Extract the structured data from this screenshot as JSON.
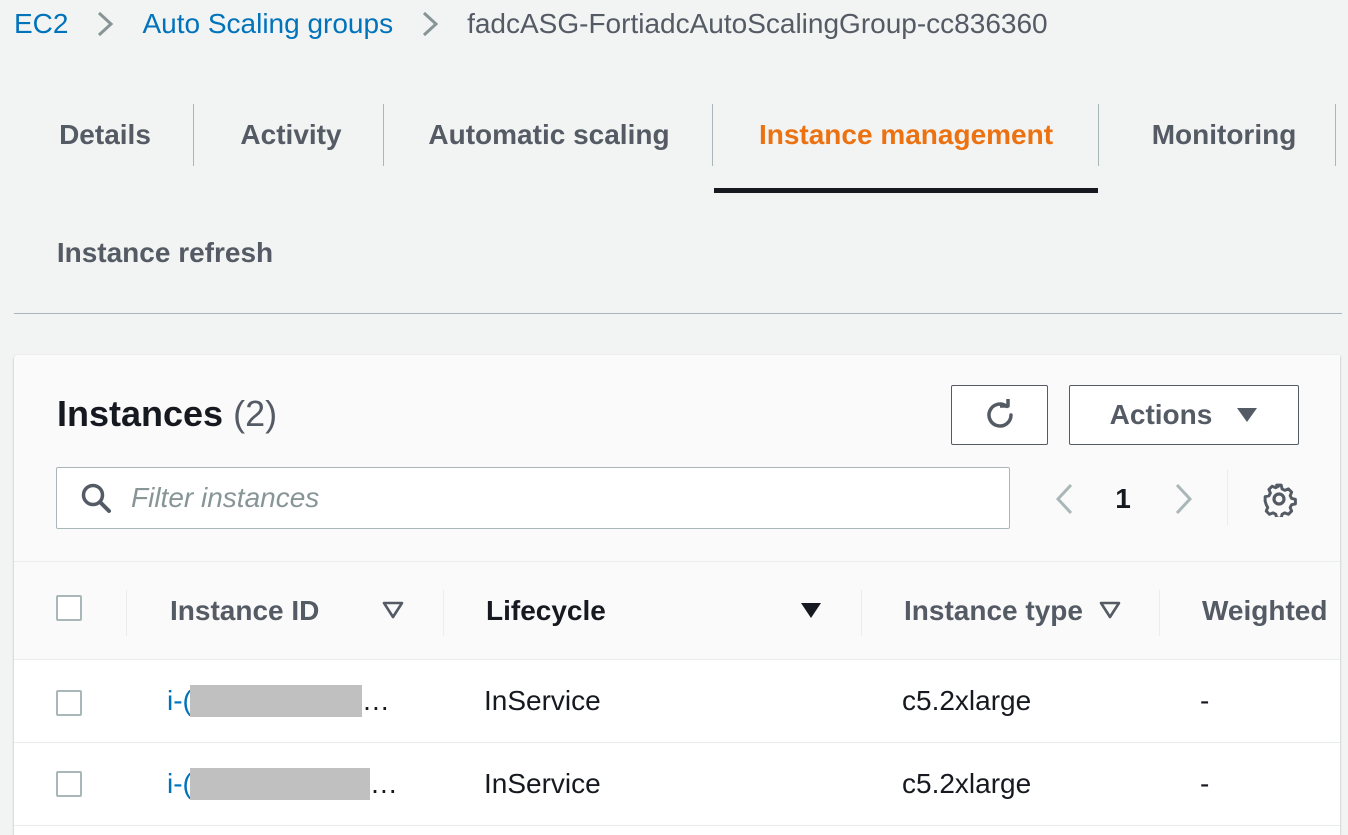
{
  "breadcrumb": {
    "items": [
      "EC2",
      "Auto Scaling groups",
      "fadcASG-FortiadcAutoScalingGroup-cc836360"
    ]
  },
  "tabs": [
    {
      "label": "Details",
      "active": false
    },
    {
      "label": "Activity",
      "active": false
    },
    {
      "label": "Automatic scaling",
      "active": false
    },
    {
      "label": "Instance management",
      "active": true
    },
    {
      "label": "Monitoring",
      "active": false
    },
    {
      "label": "Instance refresh",
      "active": false
    }
  ],
  "instances": {
    "title": "Instances",
    "count": "(2)",
    "refresh_icon": "refresh-icon",
    "actions_label": "Actions",
    "filter_placeholder": "Filter instances",
    "page": "1",
    "columns": [
      "Instance ID",
      "Lifecycle",
      "Instance type",
      "Weighted"
    ],
    "rows": [
      {
        "id_prefix": "i-(",
        "ellipsis": "…",
        "lifecycle": "InService",
        "instance_type": "c5.2xlarge",
        "weighted": "-"
      },
      {
        "id_prefix": "i-(",
        "ellipsis": "…",
        "lifecycle": "InService",
        "instance_type": "c5.2xlarge",
        "weighted": "-"
      }
    ]
  },
  "colors": {
    "link": "#0073bb",
    "active_tab": "#ec7211",
    "text": "#16191f",
    "muted": "#545b64",
    "background": "#f2f3f3"
  }
}
